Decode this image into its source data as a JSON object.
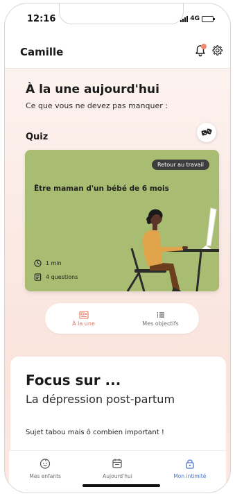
{
  "status": {
    "time": "12:16",
    "network": "4G",
    "battery_level": 0.8
  },
  "header": {
    "name": "Camille",
    "icons": [
      "bell-icon",
      "gear-icon"
    ]
  },
  "feature": {
    "title": "À la une aujourd'hui",
    "subtitle": "Ce que vous ne devez pas manquer :"
  },
  "quiz": {
    "label": "Quiz",
    "tag": "Retour au travail",
    "title": "Être maman d'un bébé de 6 mois",
    "duration": "1 min",
    "questions": "4 questions",
    "colors": {
      "card": "#a9bd72",
      "tag": "#3d3d3d"
    }
  },
  "tabs": [
    {
      "label": "À la une",
      "icon": "newspaper-icon",
      "active": true
    },
    {
      "label": "Mes objectifs",
      "icon": "list-icon",
      "active": false
    }
  ],
  "focus": {
    "title": "Focus sur ...",
    "subject": "La dépression post-partum",
    "description": "Sujet tabou mais ô combien important !"
  },
  "nav": [
    {
      "label": "Mes enfants",
      "icon": "baby-face-icon",
      "active": false
    },
    {
      "label": "Aujourd'hui",
      "icon": "calendar-icon",
      "active": false
    },
    {
      "label": "Mon intimité",
      "icon": "lock-icon",
      "active": true
    }
  ],
  "colors": {
    "accent": "#e8735a",
    "nav_active": "#4a73c9",
    "notification": "#f08a70"
  }
}
